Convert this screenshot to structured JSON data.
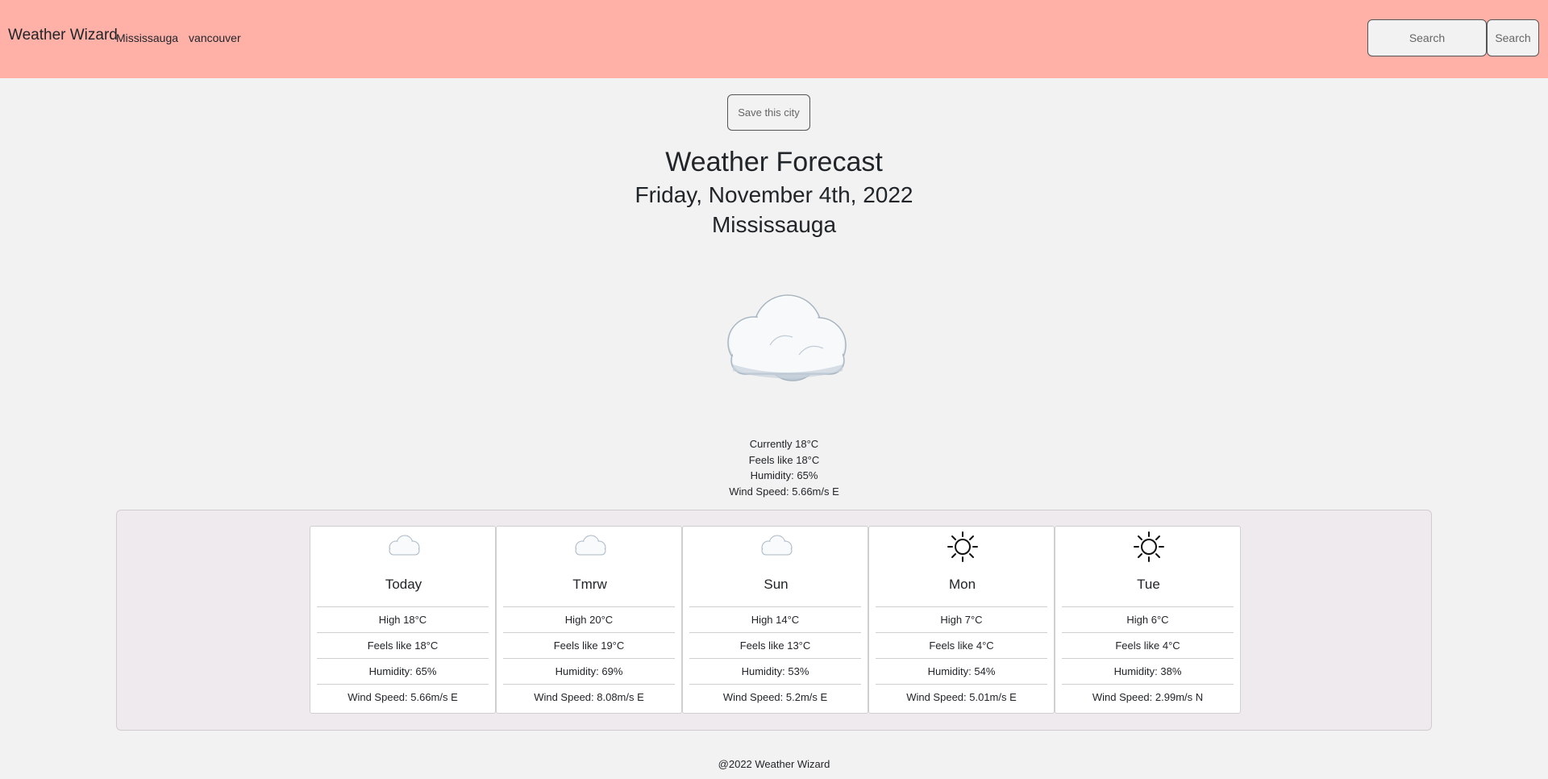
{
  "navbar": {
    "brand": "Weather Wizard",
    "saved_cities": [
      "Mississauga",
      "vancouver"
    ],
    "search_placeholder": "Search",
    "search_button": "Search",
    "background": "#ffb1a8"
  },
  "main": {
    "save_button": "Save this city",
    "title": "Weather Forecast",
    "date": "Friday, November 4th, 2022",
    "city": "Mississauga",
    "icon": "cloud-icon",
    "current": {
      "temp": "Currently 18°C",
      "feels": "Feels like 18°C",
      "humidity": "Humidity: 65%",
      "wind": "Wind Speed: 5.66m/s E"
    }
  },
  "forecast": [
    {
      "day": "Today",
      "icon": "cloud-icon",
      "high": "High 18°C",
      "feels": "Feels like 18°C",
      "humidity": "Humidity: 65%",
      "wind": "Wind Speed: 5.66m/s E"
    },
    {
      "day": "Tmrw",
      "icon": "cloud-icon",
      "high": "High 20°C",
      "feels": "Feels like 19°C",
      "humidity": "Humidity: 69%",
      "wind": "Wind Speed: 8.08m/s E"
    },
    {
      "day": "Sun",
      "icon": "cloud-icon",
      "high": "High 14°C",
      "feels": "Feels like 13°C",
      "humidity": "Humidity: 53%",
      "wind": "Wind Speed: 5.2m/s E"
    },
    {
      "day": "Mon",
      "icon": "sun-icon",
      "high": "High 7°C",
      "feels": "Feels like 4°C",
      "humidity": "Humidity: 54%",
      "wind": "Wind Speed: 5.01m/s E"
    },
    {
      "day": "Tue",
      "icon": "sun-icon",
      "high": "High 6°C",
      "feels": "Feels like 4°C",
      "humidity": "Humidity: 38%",
      "wind": "Wind Speed: 2.99m/s N"
    }
  ],
  "footer": "@2022 Weather Wizard"
}
